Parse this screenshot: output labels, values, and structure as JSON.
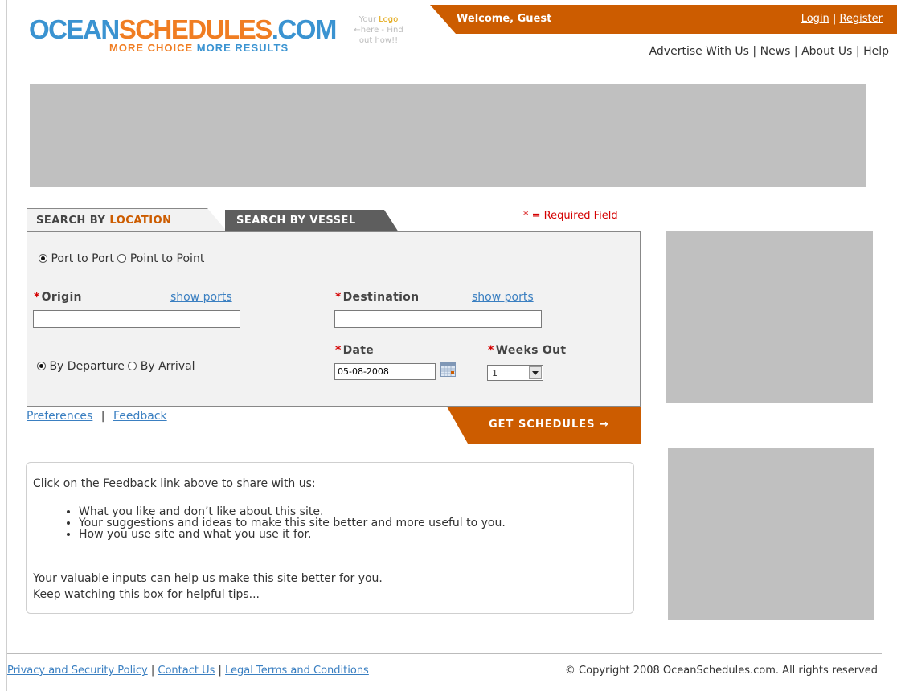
{
  "header": {
    "logo": {
      "part1": "OCEAN",
      "part2": "SCHEDULES",
      "part3": ".COM",
      "tag1": "MORE CHOICE ",
      "tag2": "MORE RESULTS"
    },
    "your_logo": {
      "line1a": "Your ",
      "line1b": "Logo",
      "line2": "←here - Find",
      "line3": "out how!!"
    },
    "welcome": "Welcome, Guest",
    "login": "Login",
    "register": "Register",
    "auth_sep": "|",
    "nav": [
      "Advertise With Us",
      "News",
      "About Us",
      "Help"
    ]
  },
  "search": {
    "tab_location_prefix": "SEARCH BY ",
    "tab_location_accent": "LOCATION",
    "tab_vessel": "SEARCH BY VESSEL",
    "required_note": "* = Required Field",
    "mode_options": [
      "Port to Port",
      "Point to Point"
    ],
    "origin_label": "Origin",
    "destination_label": "Destination",
    "show_ports": "show ports",
    "origin_value": "",
    "destination_value": "",
    "date_label": "Date",
    "date_value": "05-08-2008",
    "weeks_label": "Weeks Out",
    "weeks_value": "1",
    "timing_options": [
      "By Departure",
      "By Arrival"
    ],
    "preferences": "Preferences",
    "feedback": "Feedback",
    "link_sep": "|",
    "get_button": "GET SCHEDULES →"
  },
  "feedback_box": {
    "intro": "Click on the Feedback link above to share with us:",
    "items": [
      "What you like and don’t like about this site.",
      "Your suggestions and ideas to make this site better and more useful to you.",
      "How you use site and what you use it for."
    ],
    "outro1": "Your valuable inputs can help us make this site better for you.",
    "outro2": "Keep watching this box for helpful tips..."
  },
  "footer": {
    "links": [
      "Privacy and Security Policy",
      "Contact Us",
      "Legal Terms and Conditions"
    ],
    "sep": "|",
    "copyright": "© Copyright 2008 OceanSchedules.com. All rights reserved"
  },
  "colors": {
    "brand_orange": "#cc5c00",
    "logo_blue": "#3a93d1",
    "logo_orange": "#f07d22",
    "required_red": "#d40000",
    "link_blue": "#3a7fc1",
    "ad_gray": "#c0c0c0"
  },
  "icons": {
    "calendar": "calendar-icon",
    "dropdown": "chevron-down-icon"
  }
}
